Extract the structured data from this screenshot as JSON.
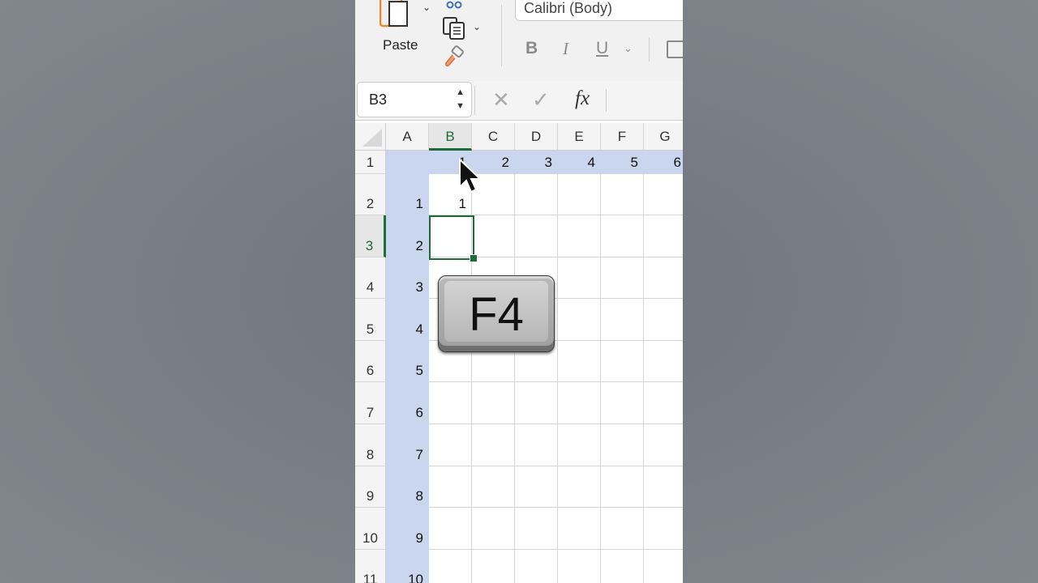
{
  "ribbon": {
    "paste_label": "Paste",
    "font_name": "Calibri (Body)",
    "bold_label": "B",
    "italic_label": "I",
    "underline_label": "U"
  },
  "formula_bar": {
    "name_box": "B3",
    "cancel_glyph": "✕",
    "enter_glyph": "✓",
    "fx_label": "fx",
    "formula_value": ""
  },
  "sheet": {
    "columns": [
      "A",
      "B",
      "C",
      "D",
      "E",
      "F",
      "G"
    ],
    "rows": [
      "1",
      "2",
      "3",
      "4",
      "5",
      "6",
      "7",
      "8",
      "9",
      "10",
      "11"
    ],
    "selected_column": "B",
    "selected_row": "3",
    "row1_values": [
      "",
      "1",
      "2",
      "3",
      "4",
      "5",
      "6"
    ],
    "colA_values": [
      "",
      "1",
      "2",
      "3",
      "4",
      "5",
      "6",
      "7",
      "8",
      "9",
      "10"
    ],
    "b2_value": "1"
  },
  "overlay": {
    "key_label": "F4"
  },
  "colors": {
    "accent": "#1e6b3a",
    "highlight": "#c9d6ee"
  }
}
